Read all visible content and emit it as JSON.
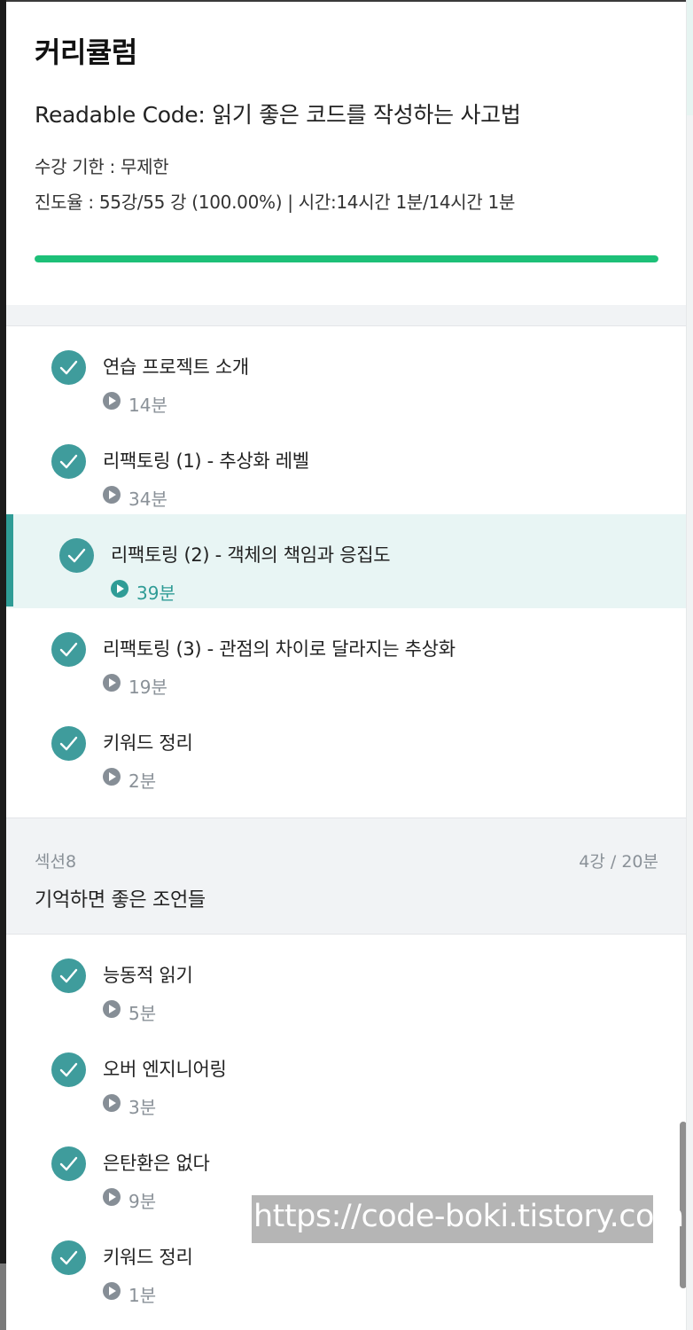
{
  "header": {
    "title": "커리큘럼",
    "course_title": "Readable Code: 읽기 좋은 코드를 작성하는 사고법",
    "period": "수강 기한 : 무제한",
    "progress_text": "진도율 : 55강/55 강 (100.00%) | 시간:14시간 1분/14시간 1분",
    "progress_percent": 100,
    "progress_color": "#1dc078"
  },
  "lessons_a": [
    {
      "title": "연습 프로젝트 소개",
      "duration": "14분",
      "completed": true,
      "icon": "check-icon"
    },
    {
      "title": "리팩토링 (1) - 추상화 레벨",
      "duration": "34분",
      "completed": true,
      "icon": "check-icon"
    },
    {
      "title": "리팩토링 (2) - 객체의 책임과 응집도",
      "duration": "39분",
      "completed": true,
      "active": true,
      "icon": "check-icon"
    },
    {
      "title": "리팩토링 (3) - 관점의 차이로 달라지는 추상화",
      "duration": "19분",
      "completed": true,
      "icon": "check-icon"
    },
    {
      "title": "키워드 정리",
      "duration": "2분",
      "completed": true,
      "icon": "check-icon"
    }
  ],
  "section": {
    "label": "섹션8",
    "count": "4강 / 20분",
    "title": "기억하면 좋은 조언들"
  },
  "lessons_b": [
    {
      "title": "능동적 읽기",
      "duration": "5분",
      "completed": true,
      "icon": "check-icon"
    },
    {
      "title": "오버 엔지니어링",
      "duration": "3분",
      "completed": true,
      "icon": "check-icon"
    },
    {
      "title": "은탄환은 없다",
      "duration": "9분",
      "completed": true,
      "icon": "check-icon"
    },
    {
      "title": "키워드 정리",
      "duration": "1분",
      "completed": true,
      "icon": "check-icon"
    }
  ],
  "watermark": "https://code-boki.tistory.com",
  "colors": {
    "accent": "#3f9c9c",
    "active_bg": "#e8f5f4",
    "active_bar": "#2f9c96",
    "section_bg": "#f1f3f5"
  }
}
